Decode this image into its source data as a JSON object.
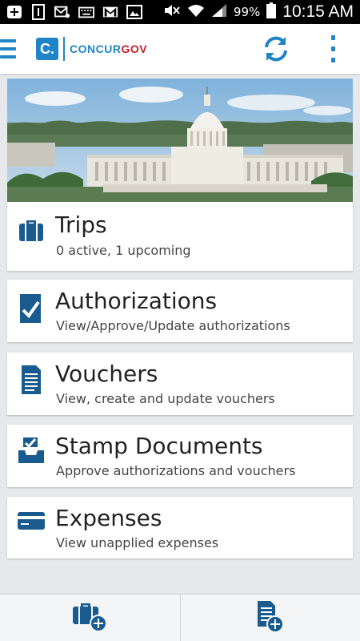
{
  "status_bar": {
    "battery": "99%",
    "time": "10:15 AM",
    "icons": [
      "add-icon",
      "sim-1-icon",
      "email-icon",
      "keyboard-icon",
      "gmail-icon",
      "image-icon",
      "mute-icon",
      "wifi-icon",
      "signal-icon",
      "battery-icon"
    ]
  },
  "header": {
    "logo_mark": "C.",
    "logo_part1": "CONCUR",
    "logo_part2": "GOV",
    "brand_color": "#1f84c8",
    "accent_color": "#c8202f",
    "icons": [
      "menu-icon",
      "sync-icon",
      "more-vertical-icon"
    ]
  },
  "hero": {
    "icon": "capitol-building-image"
  },
  "cards": [
    {
      "title": "Trips",
      "subtitle": "0 active, 1 upcoming",
      "icon": "briefcase-icon"
    },
    {
      "title": "Authorizations",
      "subtitle": "View/Approve/Update authorizations",
      "icon": "checkmark-document-icon"
    },
    {
      "title": "Vouchers",
      "subtitle": "View, create and update vouchers",
      "icon": "document-icon"
    },
    {
      "title": "Stamp Documents",
      "subtitle": "Approve authorizations and vouchers",
      "icon": "stamp-inbox-icon"
    },
    {
      "title": "Expenses",
      "subtitle": "View unapplied expenses",
      "icon": "credit-card-icon"
    }
  ],
  "bottom_bar": {
    "icons": [
      "add-trip-icon",
      "add-voucher-icon"
    ]
  }
}
